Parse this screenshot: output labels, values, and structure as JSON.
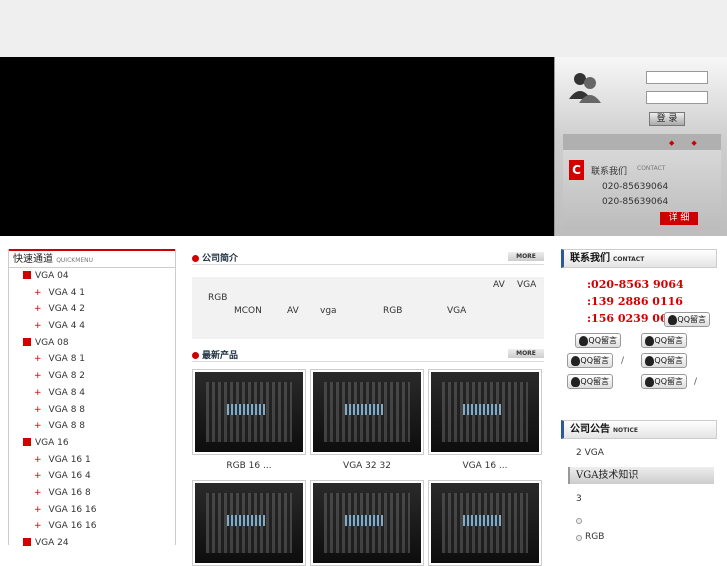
{
  "login": {
    "button": "登 录"
  },
  "contact_card": {
    "badge": "C",
    "title": "联系我们",
    "title_en": "CONTACT",
    "phones": [
      "020-85639064",
      "020-85639064"
    ],
    "detail_button": "详 细"
  },
  "quickmenu": {
    "title": "快速通道",
    "title_en": "QUICKMENU",
    "items": [
      {
        "label": "VGA  04",
        "level": "top"
      },
      {
        "label": "VGA  4 1",
        "level": "sub"
      },
      {
        "label": "VGA  4 2",
        "level": "sub"
      },
      {
        "label": "VGA  4 4",
        "level": "sub"
      },
      {
        "label": "VGA     08",
        "level": "top"
      },
      {
        "label": "VGA  8 1",
        "level": "sub"
      },
      {
        "label": "VGA  8 2",
        "level": "sub"
      },
      {
        "label": "VGA  8 4",
        "level": "sub"
      },
      {
        "label": "VGA  8 8",
        "level": "sub"
      },
      {
        "label": "VGA  8 8",
        "level": "sub"
      },
      {
        "label": "VGA     16",
        "level": "top"
      },
      {
        "label": "VGA  16 1",
        "level": "sub"
      },
      {
        "label": "VGA  16 4",
        "level": "sub"
      },
      {
        "label": "VGA  16 8",
        "level": "sub"
      },
      {
        "label": "VGA  16 16",
        "level": "sub"
      },
      {
        "label": "VGA  16 16",
        "level": "sub"
      },
      {
        "label": "VGA     24",
        "level": "top"
      }
    ]
  },
  "about": {
    "title": "公司简介",
    "more": "MORE",
    "words": [
      "AV",
      "VGA",
      "RGB",
      "MCON",
      "AV",
      "vga",
      "RGB",
      "VGA"
    ]
  },
  "products": {
    "title": "最新产品",
    "more": "MORE",
    "items": [
      {
        "caption": "RGB     16 ..."
      },
      {
        "caption": "VGA  32 32"
      },
      {
        "caption": "VGA     16 ..."
      },
      {
        "caption": ""
      },
      {
        "caption": ""
      },
      {
        "caption": ""
      }
    ]
  },
  "right_contact": {
    "title": "联系我们",
    "title_en": "CONTACT",
    "phones": [
      ":020-8563 9064",
      ":139 2886 0116",
      ":156 0239 0606"
    ],
    "qq_label": "QQ留言",
    "slashes": [
      "/",
      "/"
    ]
  },
  "notice": {
    "title": "公司公告",
    "title_en": "NOTICE",
    "line1": "2    VGA",
    "bar": "VGA技术知识",
    "line2": "3",
    "line3": "RGB"
  },
  "colors": {
    "accent": "#d40000",
    "banner": "#000000",
    "head_border": "#2a5a9a"
  }
}
